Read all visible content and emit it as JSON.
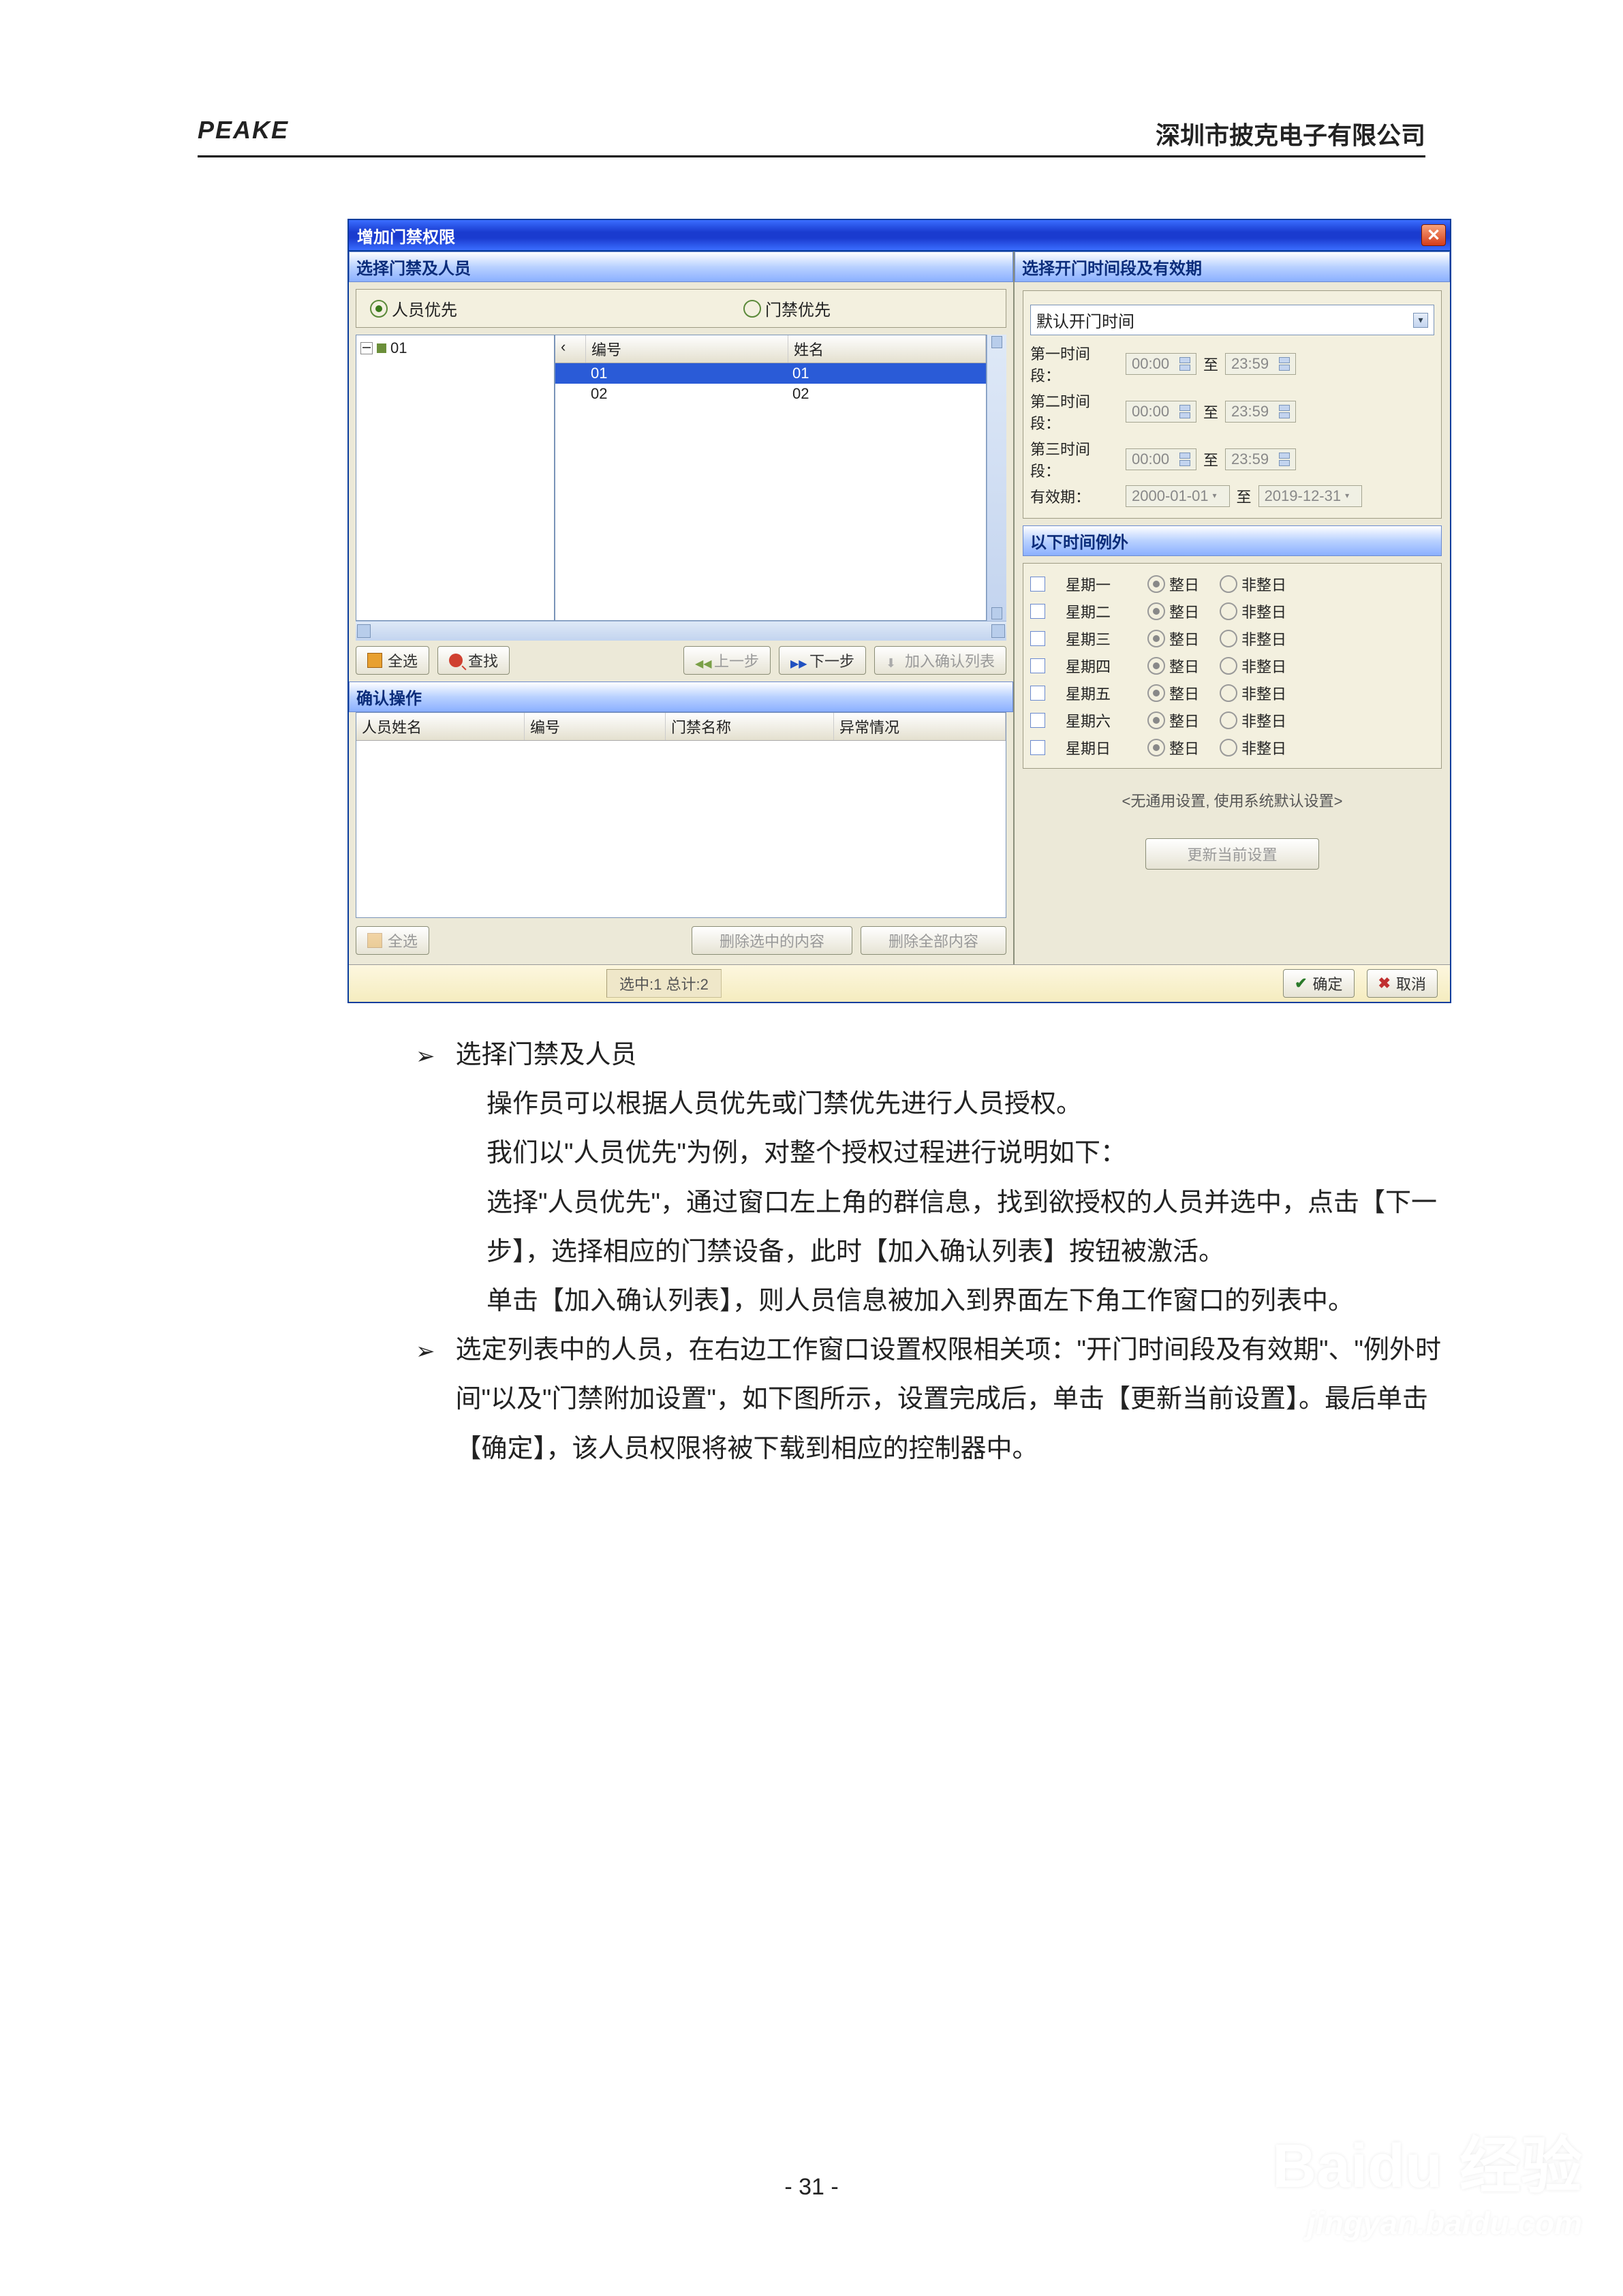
{
  "header": {
    "brand": "PEAKE",
    "company": "深圳市披克电子有限公司"
  },
  "dialog": {
    "title": "增加门禁权限",
    "left_section": "选择门禁及人员",
    "right_section": "选择开门时间段及有效期",
    "radio_person": "人员优先",
    "radio_gate": "门禁优先",
    "tree_root": "01",
    "list": {
      "col_num": "编号",
      "col_name": "姓名",
      "rows": [
        {
          "num": "01",
          "name": "01"
        },
        {
          "num": "02",
          "name": "02"
        }
      ]
    },
    "btn_selectall": "全选",
    "btn_find": "查找",
    "btn_prev": "上一步",
    "btn_next": "下一步",
    "btn_addlist": "加入确认列表",
    "confirm_section": "确认操作",
    "confirm_cols": {
      "a": "人员姓名",
      "b": "编号",
      "c": "门禁名称",
      "d": "异常情况"
    },
    "btn_selectall2": "全选",
    "btn_delsel": "删除选中的内容",
    "btn_delall": "删除全部内容",
    "open_default": "默认开门时间",
    "t1": "第一时间段：",
    "t2": "第二时间段：",
    "t3": "第三时间段：",
    "time_from": "00:00",
    "to": "至",
    "time_to": "23:59",
    "valid": "有效期：",
    "valid_from": "2000-01-01",
    "valid_to": "2019-12-31",
    "except_section": "以下时间例外",
    "weekdays": [
      "星期一",
      "星期二",
      "星期三",
      "星期四",
      "星期五",
      "星期六",
      "星期日"
    ],
    "opt_full": "整日",
    "opt_notfull": "非整日",
    "note": "<无通用设置, 使用系统默认设置>",
    "btn_update": "更新当前设置",
    "status": "选中:1 总计:2",
    "ok": "确定",
    "cancel": "取消"
  },
  "text": {
    "b1_title": "选择门禁及人员",
    "p1": "操作员可以根据人员优先或门禁优先进行人员授权。",
    "p2": "我们以\"人员优先\"为例，对整个授权过程进行说明如下：",
    "p3": "选择\"人员优先\"，通过窗口左上角的群信息，找到欲授权的人员并选中，点击【下一步】，选择相应的门禁设备，此时【加入确认列表】按钮被激活。",
    "p4": "单击【加入确认列表】，则人员信息被加入到界面左下角工作窗口的列表中。",
    "b2": "选定列表中的人员，在右边工作窗口设置权限相关项：\"开门时间段及有效期\"、\"例外时间\"以及\"门禁附加设置\"，如下图所示，设置完成后，单击【更新当前设置】。最后单击【确定】，该人员权限将被下载到相应的控制器中。"
  },
  "page_number": "- 31 -",
  "watermark": {
    "main": "Baidu 经验",
    "sub": "jingyan.baidu.com"
  }
}
